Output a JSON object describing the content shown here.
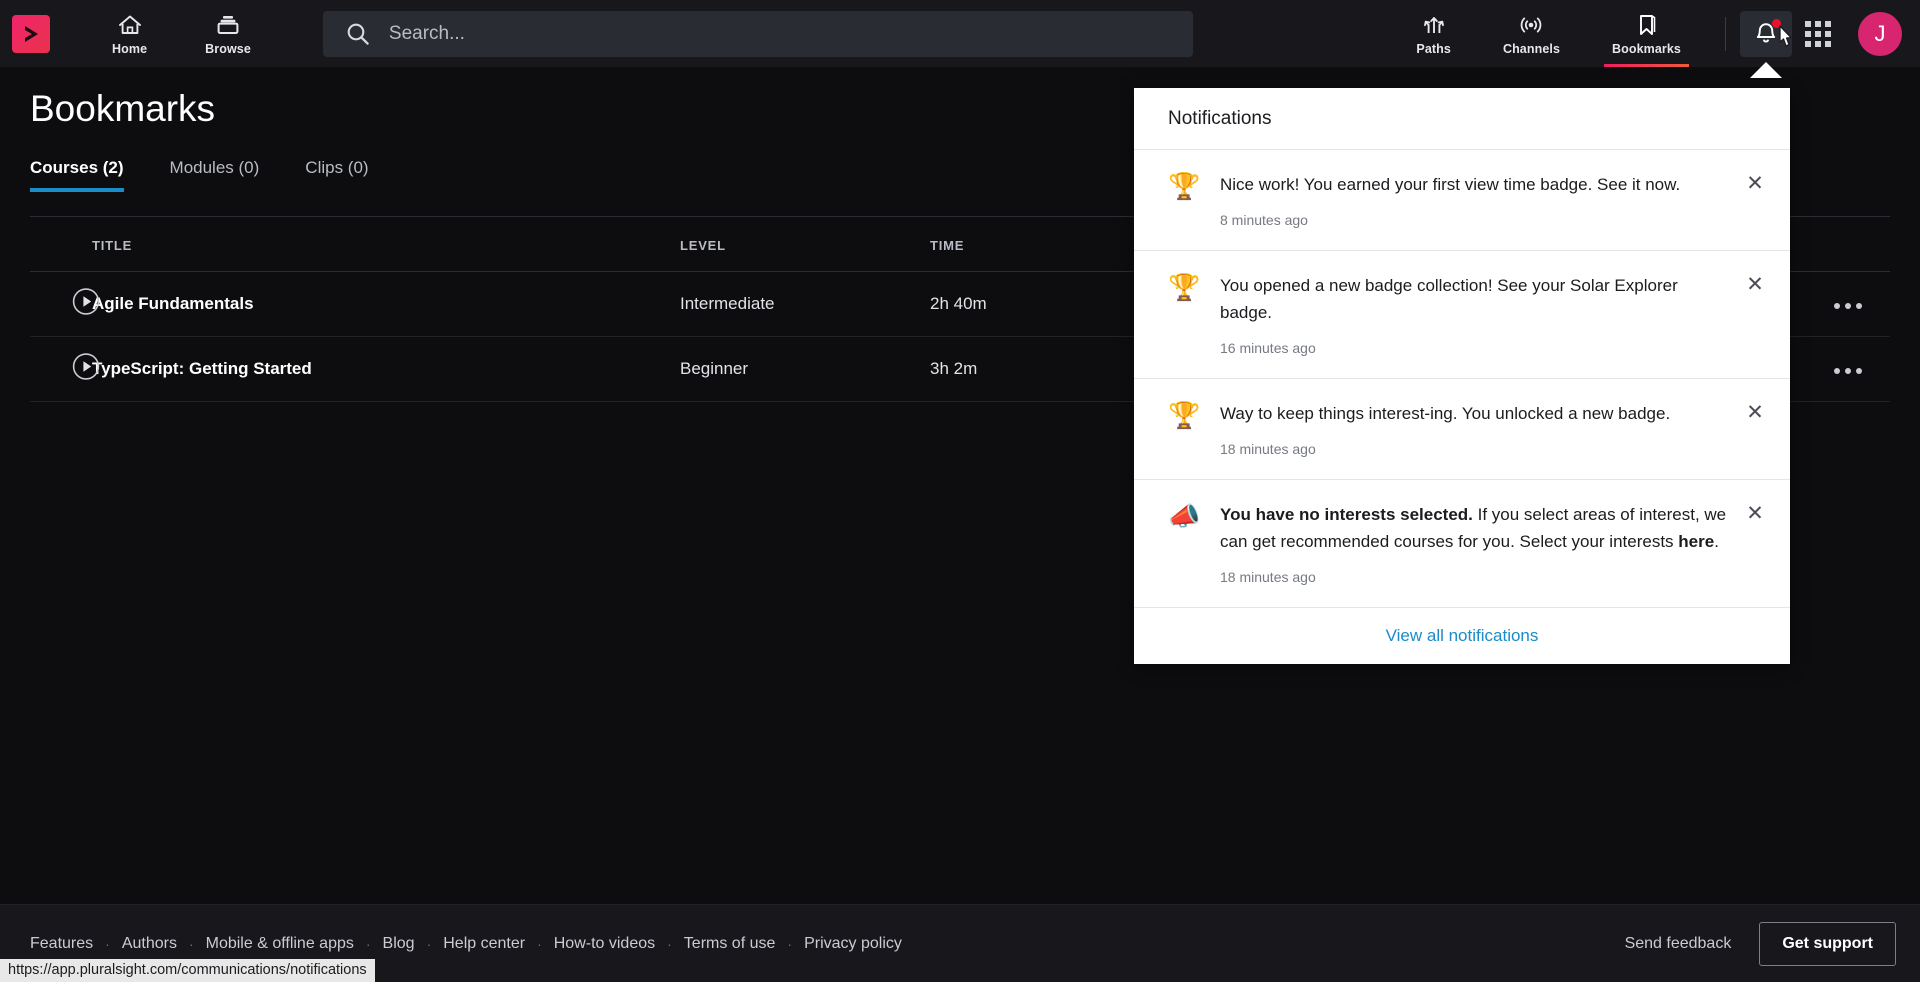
{
  "topnav": {
    "logo_name": "pluralsight-logo",
    "home_label": "Home",
    "browse_label": "Browse",
    "paths_label": "Paths",
    "channels_label": "Channels",
    "bookmarks_label": "Bookmarks",
    "avatar_initial": "J",
    "accent_pink": "#ef1e63",
    "notification_dot_color": "#e8112d"
  },
  "search": {
    "placeholder": "Search...",
    "value": ""
  },
  "main": {
    "page_title": "Bookmarks",
    "active_tab_underline_color": "#1a8cc8",
    "tabs": [
      {
        "label": "Courses (2)",
        "active": true
      },
      {
        "label": "Modules (0)",
        "active": false
      },
      {
        "label": "Clips (0)",
        "active": false
      }
    ],
    "table": {
      "headers": [
        "TITLE",
        "LEVEL",
        "TIME",
        ""
      ],
      "rows": [
        {
          "title": "Agile Fundamentals",
          "level": "Intermediate",
          "time": "2h 40m"
        },
        {
          "title": "TypeScript: Getting Started",
          "level": "Beginner",
          "time": "3h 2m"
        }
      ]
    }
  },
  "notifications": {
    "title": "Notifications",
    "close_glyph": "✕",
    "items": [
      {
        "icon": "trophy-icon",
        "glyph": "🏆",
        "text_html": "Nice work! You earned your first view time badge. See it now.",
        "time": "8 minutes ago"
      },
      {
        "icon": "trophy-icon",
        "glyph": "🏆",
        "text_html": "You opened a new badge collection! See your Solar Explorer badge.",
        "time": "16 minutes ago"
      },
      {
        "icon": "trophy-icon",
        "glyph": "🏆",
        "text_html": "Way to keep things interest-ing. You unlocked a new badge.",
        "time": "18 minutes ago"
      },
      {
        "icon": "megaphone-icon",
        "glyph": "📣",
        "text_html": "<b>You have no interests selected.</b> If you select areas of interest, we can get recommended courses for you. Select your interests <span class=\"lnk\">here</span>.",
        "time": "18 minutes ago"
      }
    ],
    "view_all_label": "View all notifications",
    "link_color": "#1a8cc8"
  },
  "footer": {
    "links": [
      "Features",
      "Authors",
      "Mobile & offline apps",
      "Blog",
      "Help center",
      "How-to videos",
      "Terms of use",
      "Privacy policy"
    ],
    "separator": "·",
    "send_feedback_label": "Send feedback",
    "get_support_label": "Get support"
  },
  "status_bar": {
    "url": "https://app.pluralsight.com/communications/notifications"
  }
}
